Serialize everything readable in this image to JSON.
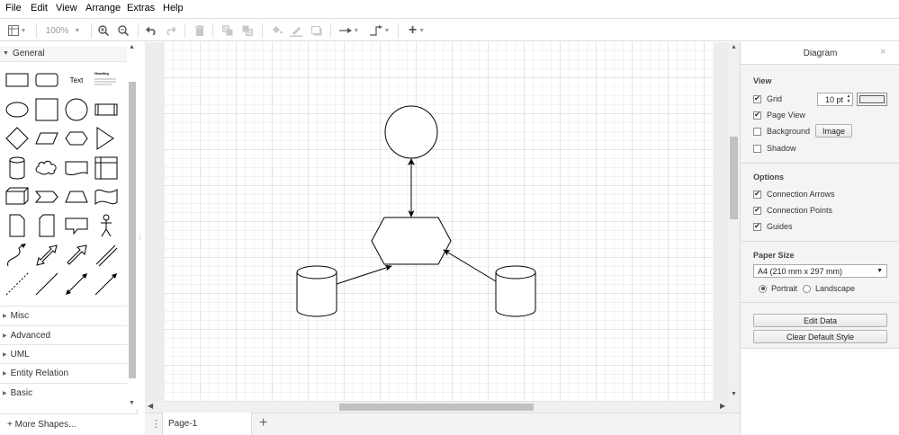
{
  "menubar": {
    "items": [
      "File",
      "Edit",
      "View",
      "Arrange",
      "Extras",
      "Help"
    ]
  },
  "toolbar": {
    "zoom": "100%"
  },
  "sidebar": {
    "general_label": "General",
    "text_shape_label": "Text",
    "heading_shape_label": "Heading",
    "categories": [
      "Misc",
      "Advanced",
      "UML",
      "Entity Relation",
      "Basic"
    ],
    "more_shapes_label": "+ More Shapes..."
  },
  "tabs": {
    "page1": "Page-1"
  },
  "format_panel": {
    "tab_label": "Diagram",
    "close_icon": "×",
    "view": {
      "title": "View",
      "grid_label": "Grid",
      "grid_checked": true,
      "grid_size": "10 pt",
      "page_view_label": "Page View",
      "page_view_checked": true,
      "background_label": "Background",
      "background_checked": false,
      "image_button": "Image",
      "shadow_label": "Shadow",
      "shadow_checked": false
    },
    "options": {
      "title": "Options",
      "connection_arrows": "Connection Arrows",
      "connection_points": "Connection Points",
      "guides": "Guides"
    },
    "paper": {
      "title": "Paper Size",
      "size": "A4 (210 mm x 297 mm)",
      "portrait": "Portrait",
      "landscape": "Landscape",
      "orientation": "portrait"
    },
    "actions": {
      "edit_data": "Edit Data",
      "clear_style": "Clear Default Style"
    }
  },
  "diagram": {
    "stroke_color": "#000000",
    "fill_color": "#ffffff",
    "shapes": [
      "circle",
      "hexagon",
      "cylinder",
      "cylinder"
    ],
    "connectors": [
      "hexagon-to-circle bidirectional",
      "left-cylinder-to-hexagon",
      "right-cylinder-to-hexagon"
    ]
  },
  "colors": {
    "grid_major": "#e4e4e4",
    "grid_minor": "#f3f3f3",
    "canvas_bg": "#ededed",
    "scroll_thumb": "#c1c1c1"
  }
}
